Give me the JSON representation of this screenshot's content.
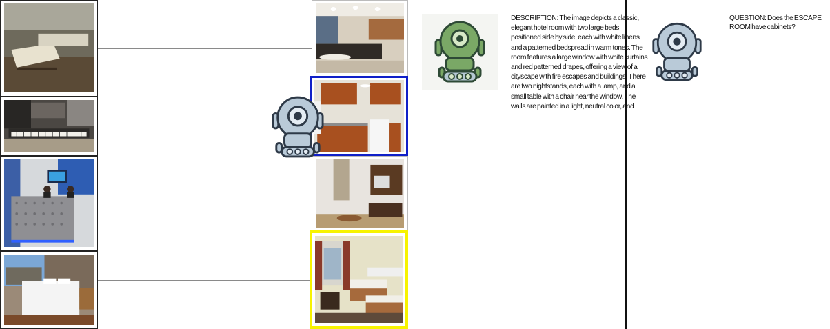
{
  "panel": {
    "description": "DESCRIPTION: The image depicts a classic, elegant hotel room with two large beds positioned side by side, each with white linens and a patterned bedspread in warm tones. The room features a large window with white curtains and red patterned drapes, offering a view of a cityscape with fire escapes and buildings. There are two nightstands, each with a lamp, and a small table with a chair near the window. The walls are painted in a light, neutral color, and",
    "question": "QUESTION: Does the ESCAPE ROOM have cabinets?"
  },
  "left_images": [
    {
      "subject": "old bedroom with twin beds"
    },
    {
      "subject": "synthesizer keyboard studio"
    },
    {
      "subject": "front desk reception with monitor"
    },
    {
      "subject": "hotel bedroom with white bed"
    }
  ],
  "right_images": [
    {
      "subject": "office lobby lounge"
    },
    {
      "subject": "kitchen with wood cabinets",
      "state": "selected-blue"
    },
    {
      "subject": "small room with tv and desk"
    },
    {
      "subject": "hotel room with two beds",
      "state": "selected-yellow"
    }
  ],
  "robots": [
    {
      "icon": "robot-icon",
      "color": "#b5c8d6"
    },
    {
      "icon": "robot-icon",
      "color": "#6fa05a"
    },
    {
      "icon": "robot-icon",
      "color": "#b5c8d6"
    }
  ]
}
